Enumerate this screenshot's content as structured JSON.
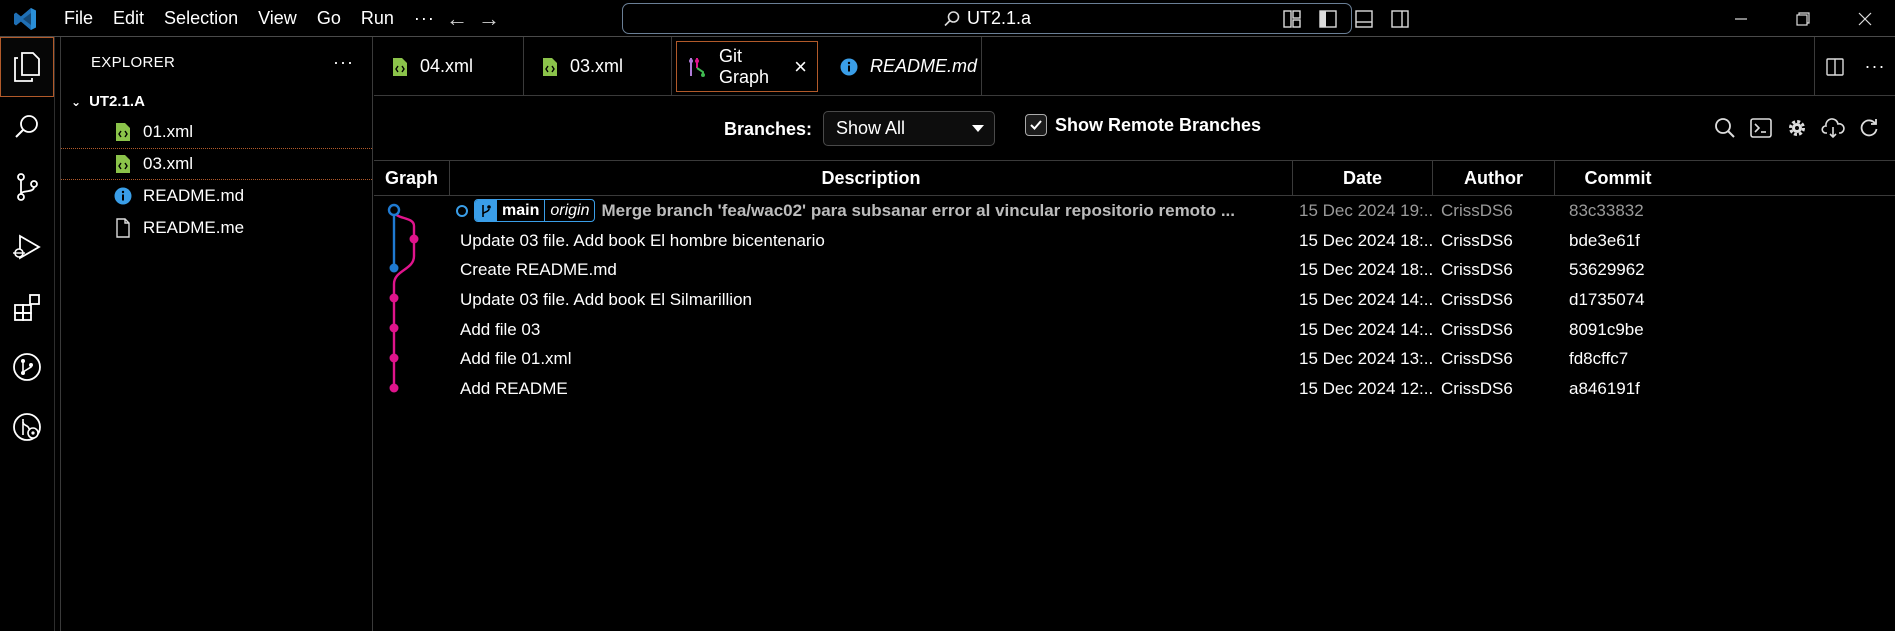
{
  "titlebar": {
    "menu": [
      "File",
      "Edit",
      "Selection",
      "View",
      "Go",
      "Run"
    ],
    "more": "···",
    "command_center": "UT2.1.a"
  },
  "sidebar": {
    "title": "EXPLORER",
    "more": "···",
    "folder": "UT2.1.A",
    "files": [
      {
        "name": "01.xml",
        "icon": "xml-file-icon"
      },
      {
        "name": "03.xml",
        "icon": "xml-file-icon"
      },
      {
        "name": "README.md",
        "icon": "info-icon"
      },
      {
        "name": "README.me",
        "icon": "file-icon"
      }
    ]
  },
  "tabs": [
    {
      "label": "04.xml",
      "icon": "xml-file-icon"
    },
    {
      "label": "03.xml",
      "icon": "xml-file-icon"
    },
    {
      "label": "Git Graph",
      "icon": "git-graph-icon",
      "active": true
    },
    {
      "label": "README.md",
      "icon": "info-icon"
    }
  ],
  "controls": {
    "branches_label": "Branches:",
    "branches_value": "Show All",
    "show_remote_label": "Show Remote Branches",
    "show_remote_checked": true
  },
  "table": {
    "headers": [
      "Graph",
      "Description",
      "Date",
      "Author",
      "Commit"
    ],
    "rows": [
      {
        "description": "Merge branch 'fea/wac02' para subsanar error al vincular repositorio remoto ...",
        "date": "15 Dec 2024 19:...",
        "author": "CrissDS6",
        "commit": "83c33832",
        "refs": {
          "branch": "main",
          "remote": "origin"
        }
      },
      {
        "description": "Update 03 file. Add book El hombre bicentenario",
        "date": "15 Dec 2024 18:...",
        "author": "CrissDS6",
        "commit": "bde3e61f"
      },
      {
        "description": "Create README.md",
        "date": "15 Dec 2024 18:...",
        "author": "CrissDS6",
        "commit": "53629962"
      },
      {
        "description": "Update 03 file. Add book El Silmarillion",
        "date": "15 Dec 2024 14:...",
        "author": "CrissDS6",
        "commit": "d1735074"
      },
      {
        "description": "Add file 03",
        "date": "15 Dec 2024 14:...",
        "author": "CrissDS6",
        "commit": "8091c9be"
      },
      {
        "description": "Add file 01.xml",
        "date": "15 Dec 2024 13:...",
        "author": "CrissDS6",
        "commit": "fd8cffc7"
      },
      {
        "description": "Add README",
        "date": "15 Dec 2024 12:...",
        "author": "CrissDS6",
        "commit": "a846191f"
      }
    ]
  },
  "colors": {
    "accent": "#3a9ee8",
    "graph_main": "#1f7ad1",
    "graph_branch": "#e0148c",
    "focus_border": "#b25a2a",
    "xml_icon": "#8bc34a"
  }
}
